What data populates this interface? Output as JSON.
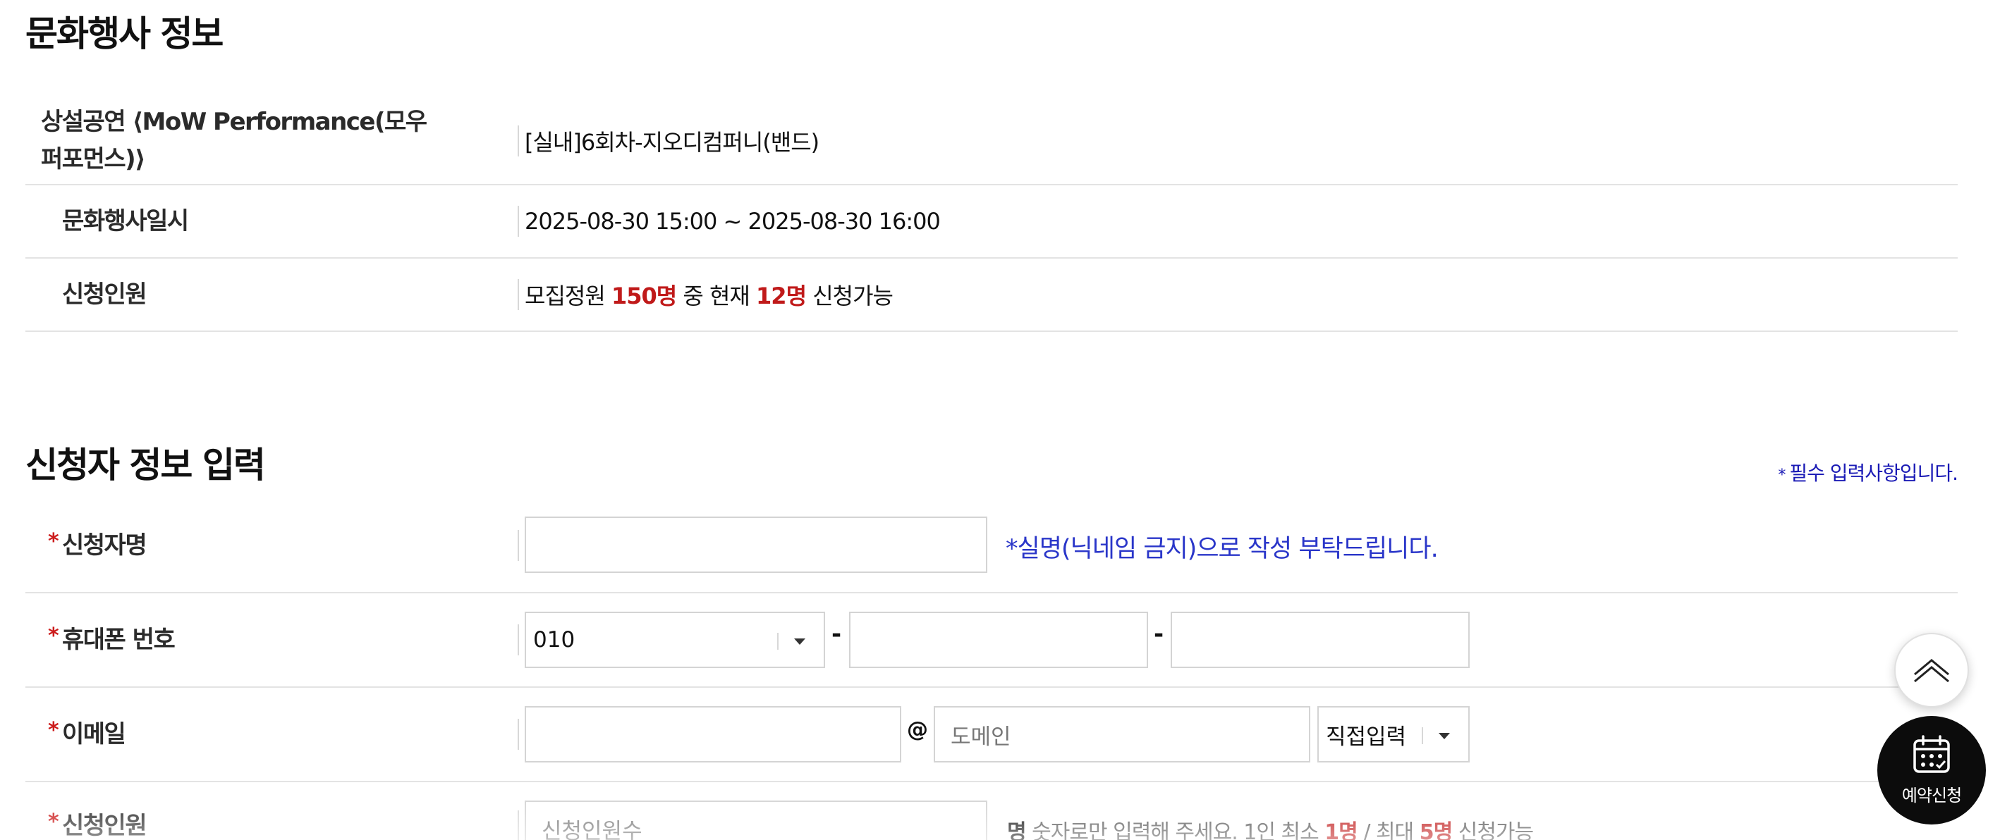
{
  "event_section": {
    "title": "문화행사 정보",
    "rows": [
      {
        "label": "상설공연 ⟨MoW Performance(모우 퍼포먼스)⟩",
        "value": "[실내]6회차-지오디컴퍼니(밴드)"
      },
      {
        "label": "문화행사일시",
        "value": "2025-08-30 15:00 ~ 2025-08-30 16:00"
      },
      {
        "label": "신청인원",
        "value_parts": {
          "prefix": "모집정원",
          "capacity": "150명",
          "middle": "중 현재",
          "available": "12명",
          "suffix": "신청가능"
        }
      }
    ]
  },
  "applicant_section": {
    "title": "신청자 정보 입력",
    "required_note": "필수 입력사항입니다.",
    "required_mark": "*",
    "name": {
      "label": "신청자명",
      "value": "",
      "hint": "*실명(닉네임 금지)으로 작성 부탁드립니다."
    },
    "phone": {
      "label": "휴대폰 번호",
      "prefix_selected": "010",
      "separator": "-",
      "middle": "",
      "last": ""
    },
    "email": {
      "label": "이메일",
      "local": "",
      "at": "@",
      "domain_placeholder": "도메인",
      "domain_select": "직접입력"
    },
    "headcount": {
      "label": "신청인원",
      "placeholder": "신청인원수",
      "unit": "명",
      "hint_parts": {
        "a": "숫자로만 입력해 주세요. 1인 최소",
        "min": "1명",
        "sep": "/ 최대",
        "max": "5명",
        "b": "신청가능"
      }
    }
  },
  "floating": {
    "top_button": "chevron-up-icon",
    "booking_label": "예약신청",
    "booking_icon": "calendar-icon"
  },
  "colors": {
    "accent_red": "#c01a1a",
    "hint_blue": "#2a36c9",
    "note_blue": "#1a1ab5",
    "fab_dark": "#0c0c0c"
  }
}
